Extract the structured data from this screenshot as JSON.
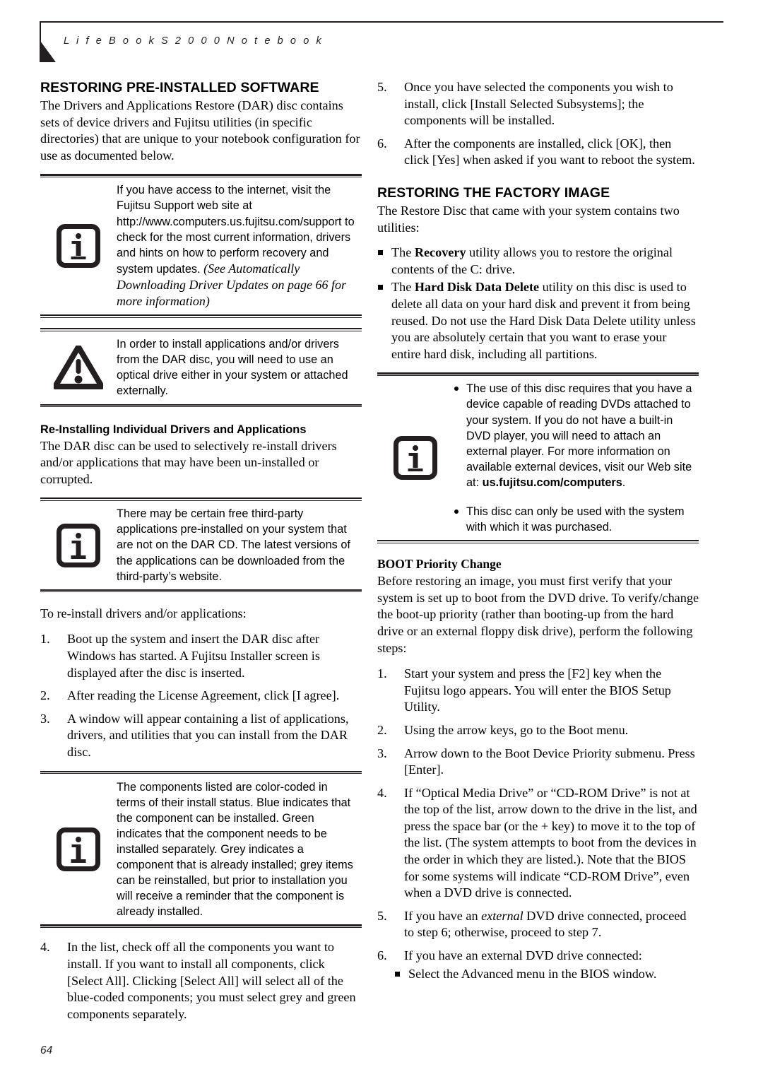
{
  "header": {
    "title": "L i f e B o o k   S 2 0 0 0   N o t e b o o k"
  },
  "footer": {
    "page_number": "64"
  },
  "left_column": {
    "section_heading": "RESTORING PRE-INSTALLED SOFTWARE",
    "intro_paragraph": "The Drivers and Applications Restore (DAR) disc contains sets of device drivers and Fujitsu utilities (in specific directories) that are unique to your notebook configuration for use as documented below.",
    "note_internet": {
      "icon": "info-icon",
      "text_plain": "If you have access to the internet, visit the Fujitsu Support web site at http://www.computers.us.fujitsu.com/support to check for the most current information, drivers and hints on how to perform recovery and system updates. ",
      "text_italic": "(See Automatically Downloading Driver Updates on page 66 for more information)"
    },
    "note_optical_drive": {
      "icon": "warning-icon",
      "text": "In order to install applications and/or drivers from the DAR disc, you will need to use an optical drive either in your system or attached externally."
    },
    "subsection_heading": "Re-Installing Individual Drivers and Applications",
    "subsection_paragraph": "The DAR disc can be used to selectively re-install drivers and/or applications that may have been un-installed or corrupted.",
    "note_third_party": {
      "icon": "info-icon",
      "text": "There may be certain free third-party applications pre-installed on your system that are not on the DAR CD. The latest versions of the applications can be downloaded from the third-party’s website."
    },
    "lead_in": "To re-install drivers and/or applications:",
    "steps": [
      {
        "num": "1.",
        "text": "Boot up the system and insert the DAR disc after Windows has started. A Fujitsu Installer screen is displayed after the disc is inserted."
      },
      {
        "num": "2.",
        "text": "After reading the License Agreement, click [I agree]."
      },
      {
        "num": "3.",
        "text": "A window will appear containing a list of applications, drivers, and utilities that you can install from the DAR disc."
      }
    ],
    "note_color_coded": {
      "icon": "info-icon",
      "text": "The components listed are color-coded in terms of their install status. Blue indicates that the component can be installed. Green indicates that the component needs to be installed separately. Grey indicates a component that is already installed; grey items can be reinstalled, but prior to installation you will receive a reminder that the component is already installed."
    },
    "steps_after_note": [
      {
        "num": "4.",
        "text": "In the list, check off all the components you want to install. If you want to install all components, click [Select All]. Clicking [Select All] will select all of the blue-coded components; you must select grey and green components separately."
      }
    ]
  },
  "right_column": {
    "continued_steps": [
      {
        "num": "5.",
        "text": "Once you have selected the components you wish to install, click [Install Selected Subsystems]; the components will be installed."
      },
      {
        "num": "6.",
        "text": "After the components are installed, click [OK], then click [Yes] when asked if you want to reboot the system."
      }
    ],
    "section_heading": "RESTORING THE FACTORY IMAGE",
    "intro_paragraph": "The Restore Disc that came with your system contains two utilities:",
    "utilities": [
      {
        "bold": "Recovery",
        "prefix": "The ",
        "suffix": " utility allows you to restore the original contents of the C: drive."
      },
      {
        "bold": "Hard Disk Data Delete",
        "prefix": "The ",
        "suffix": " utility on this disc is used to delete all data on your hard disk and prevent it from being reused. Do not use the Hard Disk Data Delete utility unless you are absolutely certain that you want to erase your entire hard disk, including all partitions."
      }
    ],
    "note_disc": {
      "icon": "info-icon",
      "bullets": [
        {
          "text_plain": "The use of this disc requires that you have a device capable of reading DVDs attached to your system. If you do not have a built-in DVD player, you will need to attach an external player. For more information on available external devices, visit our Web site at: ",
          "text_bold": "us.fujitsu.com/computers",
          "text_tail": "."
        },
        {
          "text_plain": "This disc can only be used with the system with which it was purchased.",
          "text_bold": "",
          "text_tail": ""
        }
      ]
    },
    "subsection_heading": "BOOT Priority Change",
    "subsection_paragraph": "Before restoring an image, you must first verify that your system is set up to boot from the DVD drive. To verify/change the boot-up priority (rather than booting-up from the hard drive or an external floppy disk drive), perform the following steps:",
    "steps": [
      {
        "num": "1.",
        "text": "Start your system and press the [F2] key when the Fujitsu logo appears. You will enter the BIOS Setup Utility."
      },
      {
        "num": "2.",
        "text": "Using the arrow keys, go to the Boot menu."
      },
      {
        "num": "3.",
        "text": "Arrow down to the Boot Device Priority submenu. Press [Enter]."
      },
      {
        "num": "4.",
        "text": "If “Optical Media Drive” or “CD-ROM Drive” is not at the top of the list, arrow down to the drive in the list, and press the space bar (or the + key) to move it to the top of the list. (The system attempts to boot from the devices in the order in which they are listed.). Note that the BIOS for some systems will indicate “CD-ROM Drive”, even when a DVD drive is connected."
      }
    ],
    "step5": {
      "num": "5.",
      "prefix": "If you have an ",
      "italic": "external",
      "suffix": " DVD drive connected, proceed to step 6; otherwise, proceed to step 7."
    },
    "step6": {
      "num": "6.",
      "text": "If you have an external DVD drive connected:"
    },
    "step6_sub": "Select the Advanced menu in the BIOS window."
  }
}
